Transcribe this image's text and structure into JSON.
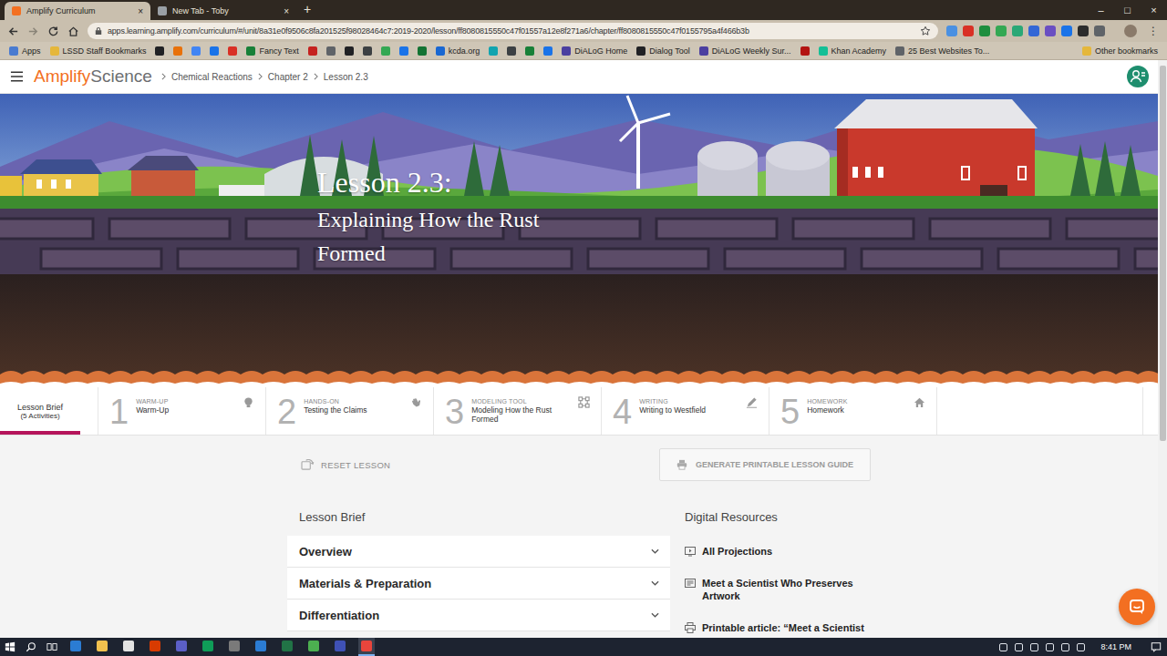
{
  "browser": {
    "tabs": [
      {
        "title": "Amplify Curriculum",
        "selected": true,
        "close": "×",
        "color": "#f37021"
      },
      {
        "title": "New Tab - Toby",
        "selected": false,
        "close": "×",
        "color": "#9aa0a6"
      }
    ],
    "new_tab": "+",
    "window_controls": [
      "–",
      "□",
      "×"
    ],
    "url": "apps.learning.amplify.com/curriculum/#/unit/8a31e0f9506c8fa201525f98028464c7:2019-2020/lesson/ff8080815550c47f01557a12e8f271a6/chapter/ff8080815550c47f0155795a4f466b3b",
    "menu": "⋮",
    "extensions": [
      {
        "color": "#4a90e2"
      },
      {
        "color": "#d93025"
      },
      {
        "color": "#1e8e3e"
      },
      {
        "color": "#34a853"
      },
      {
        "color": "#2aa876"
      },
      {
        "color": "#3367d6"
      },
      {
        "color": "#6a4fc2"
      },
      {
        "color": "#1a73e8"
      },
      {
        "color": "#2c2c2c"
      },
      {
        "color": "#5f6368"
      }
    ],
    "bookmarks": [
      {
        "label": "Apps",
        "color": "#4a7bd0"
      },
      {
        "label": "LSSD Staff Bookmarks",
        "color": "#e5b73b"
      },
      {
        "label": "",
        "color": "#202124"
      },
      {
        "label": "",
        "color": "#e8710a"
      },
      {
        "label": "",
        "color": "#4285f4"
      },
      {
        "label": "",
        "color": "#1a73e8"
      },
      {
        "label": "",
        "color": "#d93025"
      },
      {
        "label": "Fancy Text",
        "color": "#188038"
      },
      {
        "label": "",
        "color": "#c5221f"
      },
      {
        "label": "",
        "color": "#5f6368"
      },
      {
        "label": "",
        "color": "#202124"
      },
      {
        "label": "",
        "color": "#3c4043"
      },
      {
        "label": "",
        "color": "#34a853"
      },
      {
        "label": "",
        "color": "#1a73e8"
      },
      {
        "label": "",
        "color": "#137333"
      },
      {
        "label": "kcda.org",
        "color": "#1967d2"
      },
      {
        "label": "",
        "color": "#12a4af"
      },
      {
        "label": "",
        "color": "#3c4043"
      },
      {
        "label": "",
        "color": "#188038"
      },
      {
        "label": "",
        "color": "#1a73e8"
      },
      {
        "label": "DiALoG Home",
        "color": "#4b3fa0"
      },
      {
        "label": "Dialog Tool",
        "color": "#202124"
      },
      {
        "label": "DiALoG Weekly Sur...",
        "color": "#4b3fa0"
      },
      {
        "label": "",
        "color": "#b31412"
      },
      {
        "label": "Khan Academy",
        "color": "#14bf96"
      },
      {
        "label": "25 Best Websites To...",
        "color": "#5f6368"
      }
    ],
    "other_bookmarks": {
      "label": "Other bookmarks",
      "color": "#e5b73b"
    }
  },
  "page": {
    "logo": {
      "brand": "Amplify",
      "product": "Science"
    },
    "breadcrumbs": [
      "Chemical Reactions",
      "Chapter 2",
      "Lesson 2.3"
    ],
    "hero": {
      "title": "Lesson 2.3:",
      "subtitle": "Explaining How the Rust Formed"
    },
    "nav": {
      "brief": {
        "title": "Lesson Brief",
        "count": "(5 Activities)",
        "selected": true
      },
      "activities": [
        {
          "number": "1",
          "category": "WARM-UP",
          "title": "Warm-Up",
          "selected": false
        },
        {
          "number": "2",
          "category": "HANDS-ON",
          "title": "Testing the Claims",
          "selected": false
        },
        {
          "number": "3",
          "category": "MODELING TOOL",
          "title": "Modeling How the Rust Formed",
          "selected": false
        },
        {
          "number": "4",
          "category": "WRITING",
          "title": "Writing to Westfield",
          "selected": false
        },
        {
          "number": "5",
          "category": "HOMEWORK",
          "title": "Homework",
          "selected": false
        }
      ]
    },
    "actions": {
      "reset": "RESET LESSON",
      "print": {
        "label": "GENERATE PRINTABLE LESSON GUIDE",
        "disabled": true
      }
    },
    "lesson_brief": {
      "heading": "Lesson Brief",
      "sections": [
        {
          "title": "Overview",
          "expanded": false
        },
        {
          "title": "Materials & Preparation",
          "expanded": false
        },
        {
          "title": "Differentiation",
          "expanded": false
        }
      ]
    },
    "digital_resources": {
      "heading": "Digital Resources",
      "items": [
        "All Projections",
        "Meet a Scientist Who Preserves Artwork",
        "Printable article: “Meet a Scientist"
      ]
    },
    "scrollbar": {
      "level": 0.65
    }
  },
  "taskbar": {
    "apps": [
      {
        "color": "#2b7cd3",
        "active": false
      },
      {
        "color": "#f2c14e",
        "active": false
      },
      {
        "color": "#e3e3e3",
        "active": false
      },
      {
        "color": "#d83b01",
        "active": false
      },
      {
        "color": "#5b5fc7",
        "active": false
      },
      {
        "color": "#0f9d58",
        "active": false
      },
      {
        "color": "#7a7a7a",
        "active": false
      },
      {
        "color": "#2b7cd3",
        "active": false
      },
      {
        "color": "#217346",
        "active": false
      },
      {
        "color": "#4caf50",
        "active": false
      },
      {
        "color": "#3f51b5",
        "active": false
      },
      {
        "color": "#e8453c",
        "active": true
      }
    ],
    "time": "8:41 PM"
  }
}
